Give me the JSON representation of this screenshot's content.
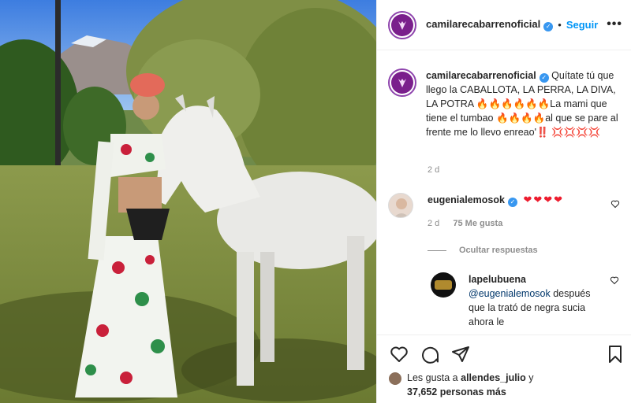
{
  "post": {
    "username": "camilarecabarrenoficial",
    "follow_label": "Seguir",
    "separator": "•",
    "more_label": "•••"
  },
  "caption": {
    "username": "camilarecabarrenoficial",
    "text": "Quítate tú que llego la CABALLOTA, LA PERRA, LA DIVA, LA POTRA 🔥🔥🔥🔥🔥🔥La mami que tiene el tumbao 🔥🔥🔥🔥al que se pare al frente me lo llevo enreao'‼️ 💢💢💢💢",
    "time": "2 d"
  },
  "comments": [
    {
      "username": "eugenialemosok",
      "text": "❤❤❤❤",
      "time": "2 d",
      "likes": "75 Me gusta"
    }
  ],
  "hide_replies_label": "Ocultar respuestas",
  "reply": {
    "username": "lapelubuena",
    "mention": "@eugenialemosok",
    "text": "después que la trató de negra sucia ahora le"
  },
  "likes_line": {
    "prefix": "Les gusta a",
    "user": "allendes_julio",
    "connector": "y",
    "count": "37,652 personas más"
  },
  "icons": {
    "like": "heart-icon",
    "comment": "comment-icon",
    "share": "paper-plane-icon",
    "save": "bookmark-icon",
    "verified": "verified-badge-icon",
    "more": "ellipsis-icon"
  },
  "colors": {
    "accent": "#0095f6",
    "verified": "#3897f0",
    "heart": "#ed1c2e",
    "muted": "#8e8e8e",
    "text": "#262626"
  }
}
